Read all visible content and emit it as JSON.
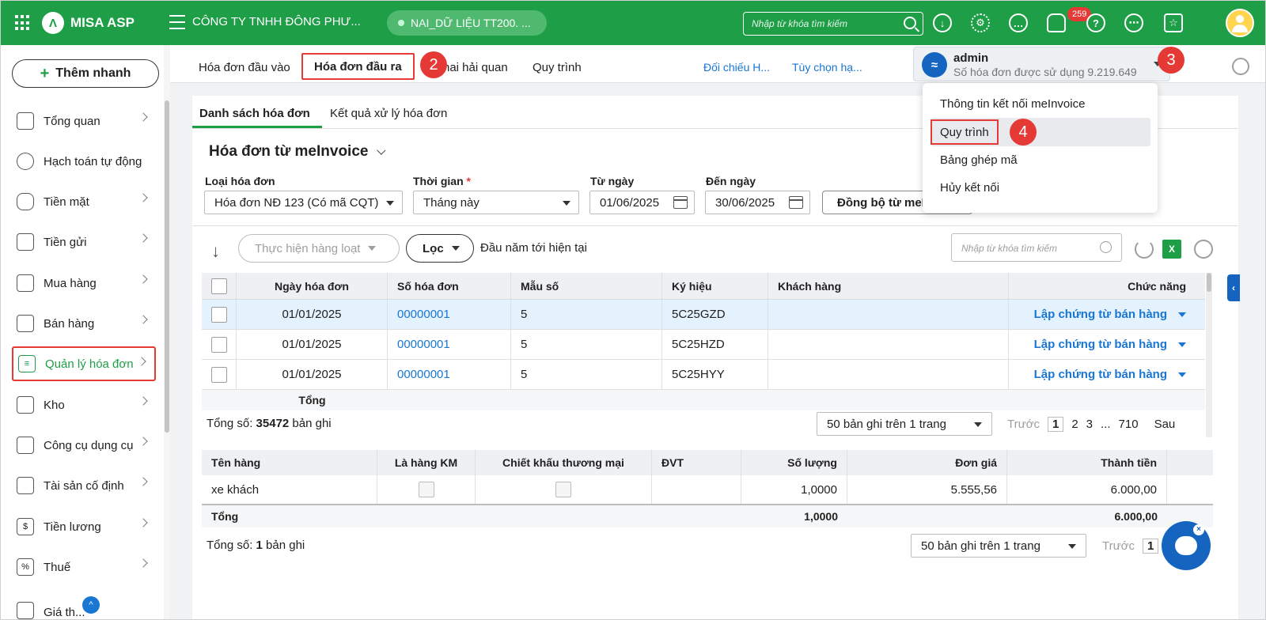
{
  "topbar": {
    "brand": "MISA ASP",
    "company": "CÔNG TY TNHH ĐÔNG PHƯ...",
    "database": "NAI_DỮ LIỆU TT200. ...",
    "search_placeholder": "Nhập từ khóa tìm kiếm",
    "notification_count": "259",
    "accent": "#1e9e47"
  },
  "sidebar": {
    "quick_add": "Thêm nhanh",
    "items": [
      {
        "label": "Tổng quan",
        "icon": "monitor-icon"
      },
      {
        "label": "Hạch toán tự động",
        "icon": "gear-icon"
      },
      {
        "label": "Tiền mặt",
        "icon": "money-bag-icon"
      },
      {
        "label": "Tiền gửi",
        "icon": "bank-icon"
      },
      {
        "label": "Mua hàng",
        "icon": "shopping-bag-icon"
      },
      {
        "label": "Bán hàng",
        "icon": "cart-icon"
      },
      {
        "label": "Quản lý hóa đơn",
        "icon": "invoice-icon"
      },
      {
        "label": "Kho",
        "icon": "warehouse-icon"
      },
      {
        "label": "Công cụ dụng cụ",
        "icon": "tools-icon"
      },
      {
        "label": "Tài sản cố định",
        "icon": "car-icon"
      },
      {
        "label": "Tiền lương",
        "icon": "salary-icon"
      },
      {
        "label": "Thuế",
        "icon": "tax-icon"
      },
      {
        "label": "Giá th...",
        "icon": "price-icon"
      }
    ]
  },
  "tabs": {
    "items": [
      "Hóa đơn đầu vào",
      "Hóa đơn đầu ra",
      "hai hải quan",
      "Quy trình"
    ],
    "links": [
      "Đối chiếu H...",
      "Tùy chọn hạ..."
    ]
  },
  "steps": [
    "2",
    "3",
    "4"
  ],
  "account": {
    "name": "admin",
    "usage": "Số hóa đơn được sử dụng 9.219.649"
  },
  "menu": {
    "items": [
      "Thông tin kết nối meInvoice",
      "Quy trình",
      "Bảng ghép mã",
      "Hủy kết nối"
    ]
  },
  "subtabs": [
    "Danh sách hóa đơn",
    "Kết quả xử lý hóa đơn"
  ],
  "section_title": "Hóa đơn từ meInvoice",
  "filters": {
    "invoice_type_label": "Loại hóa đơn",
    "invoice_type_value": "Hóa đơn NĐ 123 (Có mã CQT)",
    "period_label": "Thời gian",
    "period_value": "Tháng này",
    "from_label": "Từ ngày",
    "from_value": "01/06/2025",
    "to_label": "Đến ngày",
    "to_value": "30/06/2025",
    "sync_button": "Đồng bộ từ meI"
  },
  "toolbar": {
    "bulk_action": "Thực hiện hàng loạt",
    "filter": "Lọc",
    "period_text": "Đầu năm tới hiện tại",
    "search_placeholder": "Nhập từ khóa tìm kiếm"
  },
  "invoices": {
    "headers": [
      "Ngày hóa đơn",
      "Số hóa đơn",
      "Mẫu số",
      "Ký hiệu",
      "Khách hàng",
      "Chức năng"
    ],
    "rows": [
      {
        "date": "01/01/2025",
        "number": "00000001",
        "form": "5",
        "symbol": "5C25GZD",
        "customer": "",
        "action": "Lập chứng từ bán hàng"
      },
      {
        "date": "01/01/2025",
        "number": "00000001",
        "form": "5",
        "symbol": "5C25HZD",
        "customer": "",
        "action": "Lập chứng từ bán hàng"
      },
      {
        "date": "01/01/2025",
        "number": "00000001",
        "form": "5",
        "symbol": "5C25HYY",
        "customer": "",
        "action": "Lập chứng từ bán hàng"
      }
    ],
    "total_label": "Tổng",
    "count_prefix": "Tổng số: ",
    "count": "35472",
    "count_suffix": " bản ghi",
    "page_size": "50 bản ghi trên 1 trang",
    "prev": "Trước",
    "pages": [
      "1",
      "2",
      "3",
      "...",
      "710"
    ],
    "next": "Sau"
  },
  "details": {
    "headers": [
      "Tên hàng",
      "Là hàng KM",
      "Chiết khấu thương mại",
      "ĐVT",
      "Số lượng",
      "Đơn giá",
      "Thành tiền"
    ],
    "rows": [
      {
        "name": "xe khách",
        "unit": "",
        "qty": "1,0000",
        "price": "5.555,56",
        "amount": "6.000,00"
      }
    ],
    "total_label": "Tổng",
    "total_qty": "1,0000",
    "total_amount": "6.000,00",
    "count_prefix": "Tổng số: ",
    "count": "1",
    "count_suffix": " bản ghi",
    "page_size": "50 bản ghi trên 1 trang",
    "prev": "Trước",
    "current_page": "1"
  }
}
